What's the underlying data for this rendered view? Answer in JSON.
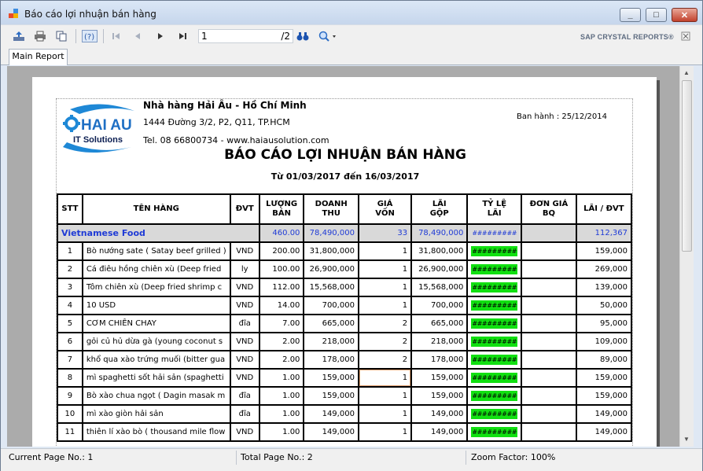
{
  "window": {
    "title": "Báo cáo lợi nhuận bán hàng",
    "minimize": "_",
    "maximize": "□",
    "close": "✕"
  },
  "toolbar": {
    "page_value": "1",
    "page_total": "/2",
    "branding": "SAP CRYSTAL REPORTS",
    "branding_mark": "®"
  },
  "tabs": [
    {
      "label": "Main Report"
    }
  ],
  "report": {
    "company_name": "Nhà hàng Hải Âu - Hồ Chí Minh",
    "address": "1444 Đường 3/2, P2, Q11, TP.HCM",
    "tel": "Tel. 08 66800734 - www.haiausolution.com",
    "issued": "Ban hành : 25/12/2014",
    "title": "BÁO CÁO LỢI NHUẬN BÁN HÀNG",
    "date_range": "Từ 01/03/2017 đến 16/03/2017",
    "logo_text": "HAI AU",
    "logo_sub": "IT Solutions",
    "columns": [
      {
        "l1": "STT",
        "l2": ""
      },
      {
        "l1": "TÊN HÀNG",
        "l2": ""
      },
      {
        "l1": "ĐVT",
        "l2": ""
      },
      {
        "l1": "LƯỢNG",
        "l2": "BÁN"
      },
      {
        "l1": "DOANH",
        "l2": "THU"
      },
      {
        "l1": "GIÁ",
        "l2": "VỐN"
      },
      {
        "l1": "LÃI",
        "l2": "GỘP"
      },
      {
        "l1": "TỶ LỆ",
        "l2": "LÃI"
      },
      {
        "l1": "ĐƠN GIÁ",
        "l2": "BQ"
      },
      {
        "l1": "LÃI / ĐVT",
        "l2": ""
      }
    ],
    "group": {
      "name": "Vietnamese Food",
      "qty": "460.00",
      "revenue": "78,490,000",
      "cost": "33",
      "profit": "78,490,000",
      "rate": "#########",
      "avg": "",
      "unit_profit": "112,367"
    },
    "rows": [
      {
        "stt": "1",
        "name": "Bò nướng sate ( Satay beef grilled )",
        "unit": "VND",
        "qty": "200.00",
        "revenue": "31,800,000",
        "cost": "1",
        "profit": "31,800,000",
        "rate": "#########",
        "avg": "",
        "unit_profit": "159,000"
      },
      {
        "stt": "2",
        "name": "Cá điêu hồng chiên xù (Deep fried",
        "unit": "ly",
        "qty": "100.00",
        "revenue": "26,900,000",
        "cost": "1",
        "profit": "26,900,000",
        "rate": "#########",
        "avg": "",
        "unit_profit": "269,000"
      },
      {
        "stt": "3",
        "name": "Tôm chiên xù (Deep fried shrimp c",
        "unit": "VND",
        "qty": "112.00",
        "revenue": "15,568,000",
        "cost": "1",
        "profit": "15,568,000",
        "rate": "#########",
        "avg": "",
        "unit_profit": "139,000"
      },
      {
        "stt": "4",
        "name": "10 USD",
        "unit": "VND",
        "qty": "14.00",
        "revenue": "700,000",
        "cost": "1",
        "profit": "700,000",
        "rate": "#########",
        "avg": "",
        "unit_profit": "50,000"
      },
      {
        "stt": "5",
        "name": "CƠM CHIÊN CHAY",
        "unit": "đĩa",
        "qty": "7.00",
        "revenue": "665,000",
        "cost": "2",
        "profit": "665,000",
        "rate": "#########",
        "avg": "",
        "unit_profit": "95,000"
      },
      {
        "stt": "6",
        "name": "gỏi củ hủ dừa gà (young coconut s",
        "unit": "VND",
        "qty": "2.00",
        "revenue": "218,000",
        "cost": "2",
        "profit": "218,000",
        "rate": "#########",
        "avg": "",
        "unit_profit": "109,000"
      },
      {
        "stt": "7",
        "name": "khổ qua xào trứng muối (bitter gua",
        "unit": "VND",
        "qty": "2.00",
        "revenue": "178,000",
        "cost": "2",
        "profit": "178,000",
        "rate": "#########",
        "avg": "",
        "unit_profit": "89,000"
      },
      {
        "stt": "8",
        "name": "mì spaghetti sốt hải sản (spaghetti",
        "unit": "VND",
        "qty": "1.00",
        "revenue": "159,000",
        "cost": "1",
        "profit": "159,000",
        "rate": "#########",
        "avg": "",
        "unit_profit": "159,000"
      },
      {
        "stt": "9",
        "name": "Bò xào chua ngọt ( Dagin masak m",
        "unit": "đĩa",
        "qty": "1.00",
        "revenue": "159,000",
        "cost": "1",
        "profit": "159,000",
        "rate": "#########",
        "avg": "",
        "unit_profit": "159,000"
      },
      {
        "stt": "10",
        "name": "mì xào giòn hải sản",
        "unit": "đĩa",
        "qty": "1.00",
        "revenue": "149,000",
        "cost": "1",
        "profit": "149,000",
        "rate": "#########",
        "avg": "",
        "unit_profit": "149,000"
      },
      {
        "stt": "11",
        "name": "thiên lí xào bò ( thousand mile flow",
        "unit": "VND",
        "qty": "1.00",
        "revenue": "149,000",
        "cost": "1",
        "profit": "149,000",
        "rate": "#########",
        "avg": "",
        "unit_profit": "149,000"
      }
    ]
  },
  "status": {
    "current_page": "Current Page No.: 1",
    "total_page": "Total Page No.: 2",
    "zoom": "Zoom Factor: 100%"
  },
  "icons": {
    "export": "export-icon",
    "print": "print-icon",
    "copy": "copy-icon",
    "group_tree": "group-tree-icon",
    "first": "first-page-icon",
    "prev": "prev-page-icon",
    "next": "next-page-icon",
    "last": "last-page-icon",
    "find": "binoculars-icon",
    "zoom": "zoom-icon"
  },
  "colors": {
    "group_text": "#1f3bd6",
    "rate_fill": "#11e011",
    "group_bg": "#d9d9d9"
  }
}
